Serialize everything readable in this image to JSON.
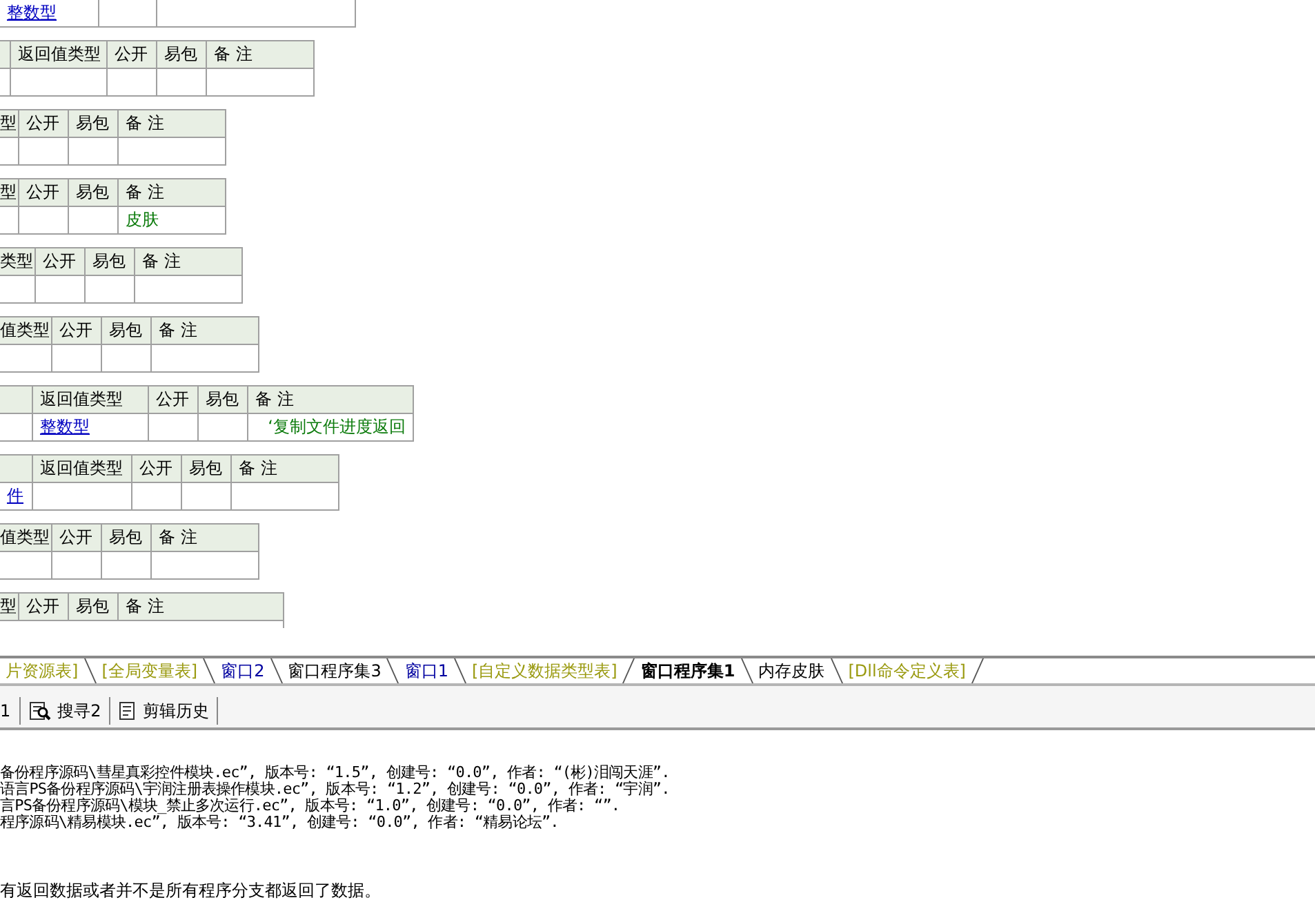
{
  "tables": [
    {
      "rows": [
        [
          {
            "text": "整数型",
            "kind": "link"
          },
          {},
          {}
        ]
      ]
    },
    {
      "header": [
        {
          "label": "返回值类型"
        },
        {
          "label": "公开"
        },
        {
          "label": "易包"
        },
        {
          "label": "备 注"
        }
      ],
      "rows": [
        [
          {},
          {},
          {},
          {},
          {}
        ]
      ]
    },
    {
      "header": [
        {
          "label": "型"
        },
        {
          "label": "公开"
        },
        {
          "label": "易包"
        },
        {
          "label": "备 注"
        }
      ],
      "rows": [
        [
          {},
          {},
          {},
          {}
        ]
      ]
    },
    {
      "header": [
        {
          "label": "型"
        },
        {
          "label": "公开"
        },
        {
          "label": "易包"
        },
        {
          "label": "备 注"
        }
      ],
      "rows": [
        [
          {},
          {},
          {},
          {
            "text": "皮肤",
            "kind": "comment"
          }
        ]
      ]
    },
    {
      "header": [
        {
          "label": "类型"
        },
        {
          "label": "公开"
        },
        {
          "label": "易包"
        },
        {
          "label": "备 注"
        }
      ],
      "rows": [
        [
          {},
          {},
          {},
          {}
        ]
      ]
    },
    {
      "header": [
        {
          "label": "值类型"
        },
        {
          "label": "公开"
        },
        {
          "label": "易包"
        },
        {
          "label": "备 注"
        }
      ],
      "rows": [
        [
          {},
          {},
          {},
          {}
        ]
      ]
    },
    {
      "header": [
        {
          "label": "返回值类型"
        },
        {
          "label": "公开"
        },
        {
          "label": "易包"
        },
        {
          "label": "备 注"
        }
      ],
      "rows": [
        [
          {},
          {
            "text": "整数型",
            "kind": "link"
          },
          {},
          {},
          {
            "text": "‘复制文件进度返回",
            "kind": "comment"
          }
        ]
      ]
    },
    {
      "header": [
        {
          "label": "返回值类型"
        },
        {
          "label": "公开"
        },
        {
          "label": "易包"
        },
        {
          "label": "备 注"
        }
      ],
      "rows": [
        [
          {
            "text": "件",
            "kind": "link"
          },
          {},
          {},
          {},
          {}
        ]
      ]
    },
    {
      "header": [
        {
          "label": "值类型"
        },
        {
          "label": "公开"
        },
        {
          "label": "易包"
        },
        {
          "label": "备 注"
        }
      ],
      "rows": [
        [
          {},
          {},
          {},
          {}
        ]
      ]
    },
    {
      "header": [
        {
          "label": "型"
        },
        {
          "label": "公开"
        },
        {
          "label": "易包"
        },
        {
          "label": "备 注"
        }
      ]
    }
  ],
  "editor_tabs": [
    {
      "label": "片资源表]",
      "kind": "table",
      "selected": false
    },
    {
      "label": "[全局变量表]",
      "kind": "table",
      "selected": false
    },
    {
      "label": "窗口2",
      "kind": "window",
      "selected": false
    },
    {
      "label": "窗口程序集3",
      "kind": "code",
      "selected": false
    },
    {
      "label": "窗口1",
      "kind": "window",
      "selected": false
    },
    {
      "label": "[自定义数据类型表]",
      "kind": "table",
      "selected": false
    },
    {
      "label": "窗口程序集1",
      "kind": "code",
      "selected": true
    },
    {
      "label": "内存皮肤",
      "kind": "code",
      "selected": false
    },
    {
      "label": "[Dll命令定义表]",
      "kind": "table",
      "selected": false
    }
  ],
  "panel_tabs": [
    {
      "label": "1",
      "kind": "plain"
    },
    {
      "label": "搜寻2",
      "kind": "search"
    },
    {
      "label": "剪辑历史",
      "kind": "clipboard"
    }
  ],
  "output_lines": [
    "备份程序源码\\彗星真彩控件模块.ec”, 版本号: “1.5”, 创建号: “0.0”, 作者: “(彬)泪闯天涯”.",
    "语言PS备份程序源码\\宇润注册表操作模块.ec”, 版本号: “1.2”, 创建号: “0.0”, 作者: “宇润”.",
    "言PS备份程序源码\\模块_禁止多次运行.ec”, 版本号: “1.0”, 创建号: “0.0”, 作者: “”.",
    "程序源码\\精易模块.ec”, 版本号: “3.41”, 创建号: “0.0”, 作者: “精易论坛”."
  ],
  "output_tail": "有返回数据或者并不是所有程序分支都返回了数据。"
}
